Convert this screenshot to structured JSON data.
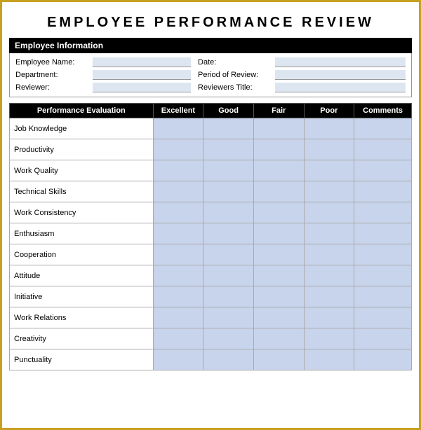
{
  "title": "EMPLOYEE  PERFORMANCE  REVIEW",
  "employee_info_header": "Employee Information",
  "fields": {
    "employee_name_label": "Employee Name:",
    "date_label": "Date:",
    "department_label": "Department:",
    "period_label": "Period of Review:",
    "reviewer_label": "Reviewer:",
    "reviewer_title_label": "Reviewers Title:"
  },
  "table": {
    "headers": {
      "performance": "Performance Evaluation",
      "excellent": "Excellent",
      "good": "Good",
      "fair": "Fair",
      "poor": "Poor",
      "comments": "Comments"
    },
    "rows": [
      "Job Knowledge",
      "Productivity",
      "Work Quality",
      "Technical Skills",
      "Work Consistency",
      "Enthusiasm",
      "Cooperation",
      "Attitude",
      "Initiative",
      "Work Relations",
      "Creativity",
      "Punctuality"
    ]
  }
}
